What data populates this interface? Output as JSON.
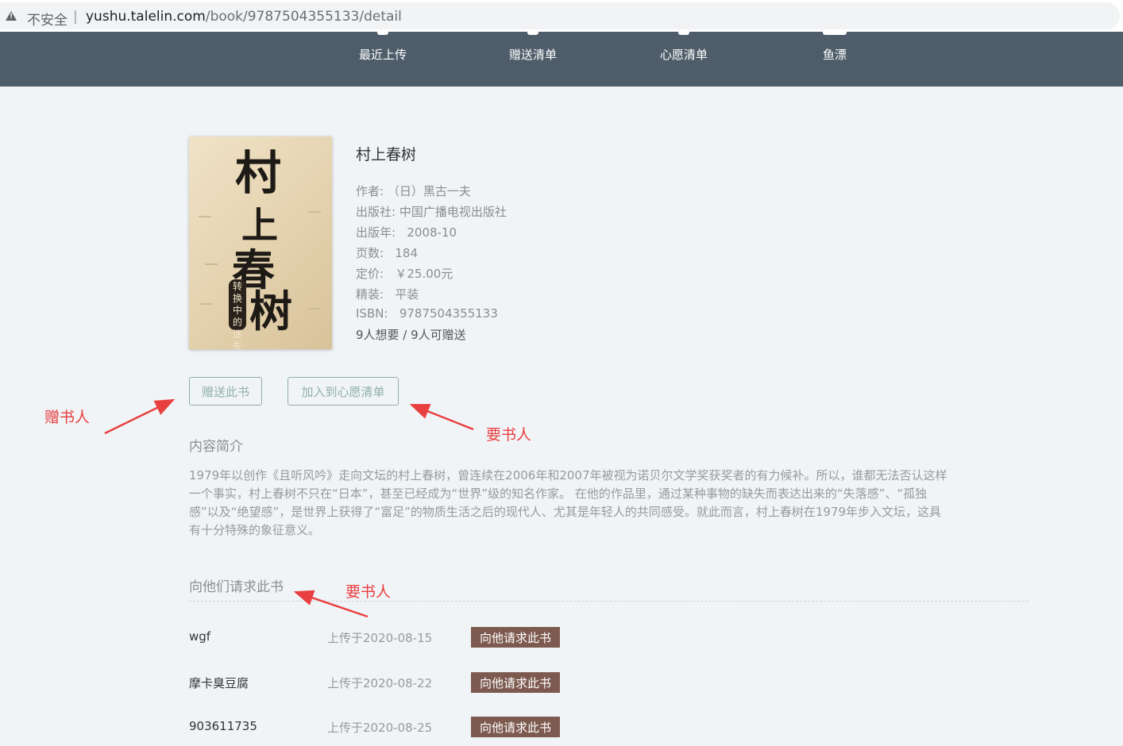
{
  "browser": {
    "security_label": "不安全",
    "url_host": "yushu.talelin.com",
    "url_path": "/book/9787504355133/detail"
  },
  "nav": {
    "items": [
      {
        "label": "最近上传"
      },
      {
        "label": "赠送清单"
      },
      {
        "label": "心愿清单"
      },
      {
        "label": "鱼漂"
      }
    ]
  },
  "book": {
    "cover_title": "村上春树",
    "cover_badge": "转换中的迷失",
    "title": "村上春树",
    "author_label": "作者:",
    "author": "（日）黑古一夫",
    "publisher_label": "出版社:",
    "publisher": "中国广播电视出版社",
    "pubdate_label": "出版年:",
    "pubdate": "2008-10",
    "pages_label": "页数:",
    "pages": "184",
    "price_label": "定价:",
    "price": "￥25.00元",
    "binding_label": "精装:",
    "binding": "平装",
    "isbn_label": "ISBN:",
    "isbn": "9787504355133",
    "want_info": "9人想要 / 9人可赠送"
  },
  "actions": {
    "gift_button": "赠送此书",
    "wish_button": "加入到心愿清单"
  },
  "summary": {
    "heading": "内容简介",
    "text": "1979年以创作《且听风吟》走向文坛的村上春树，曾连续在2006年和2007年被视为诺贝尔文学奖获奖者的有力候补。所以，谁都无法否认这样一个事实，村上春树不只在“日本”，甚至已经成为“世界”级的知名作家。 在他的作品里，通过某种事物的缺失而表达出来的“失落感”、“孤独感”以及“绝望感”，是世界上获得了“富足”的物质生活之后的现代人、尤其是年轻人的共同感受。就此而言，村上春树在1979年步入文坛，这具有十分特殊的象征意义。"
  },
  "requests": {
    "heading": "向他们请求此书",
    "rows": [
      {
        "name": "wgf",
        "date": "上传于2020-08-15",
        "button": "向他请求此书"
      },
      {
        "name": "摩卡臭豆腐",
        "date": "上传于2020-08-22",
        "button": "向他请求此书"
      },
      {
        "name": "903611735",
        "date": "上传于2020-08-25",
        "button": "向他请求此书"
      }
    ]
  },
  "annotations": {
    "gifter": "赠书人",
    "requester_1": "要书人",
    "requester_2": "要书人"
  },
  "colors": {
    "nav_bg": "#4f5d6a",
    "page_bg": "#f1f4f7",
    "outline_button": "#8fb0a6",
    "request_button": "#7d5a4f",
    "annotation": "#e84040"
  }
}
